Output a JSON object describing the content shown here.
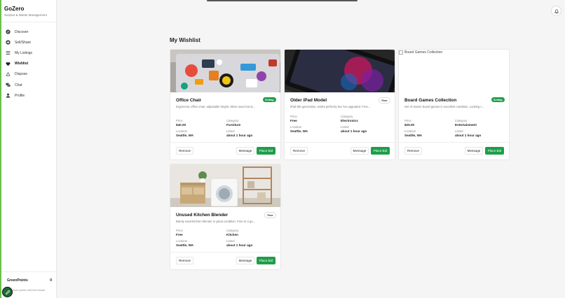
{
  "app": {
    "name": "GoZero",
    "tagline": "Surplus & Waste Management"
  },
  "nav": [
    {
      "label": "Discover",
      "icon": "compass-icon",
      "active": false
    },
    {
      "label": "Sell/Share",
      "icon": "plus-circle-icon",
      "active": false
    },
    {
      "label": "My Listings",
      "icon": "list-icon",
      "active": false
    },
    {
      "label": "Wishlist",
      "icon": "heart-icon",
      "active": true
    },
    {
      "label": "Dispose",
      "icon": "recycle-icon",
      "active": false
    },
    {
      "label": "Chat",
      "icon": "chat-bubbles-icon",
      "active": false
    },
    {
      "label": "Profile",
      "icon": "user-icon",
      "active": false
    }
  ],
  "greenpoints": {
    "label": "GreenPoints",
    "value": "0",
    "note": "more points until next reward"
  },
  "page": {
    "title": "My Wishlist"
  },
  "labels": {
    "price": "Price",
    "category": "Category",
    "location": "Location",
    "listed": "Listed",
    "remove": "Remove",
    "message": "Message",
    "place_bid": "Place Bid"
  },
  "items": [
    {
      "title": "Office Chair",
      "badge": "Selling",
      "description": "Ergonomic office chair, adjustable height. Minor wear but st...",
      "price": "$40.00",
      "category": "Furniture",
      "location": "Seattle, WA",
      "listed": "about 1 hour ago",
      "image": "laptop-stickers-photo"
    },
    {
      "title": "Older iPad Model",
      "badge": "Free",
      "description": "iPad 6th generation, works perfectly but I've upgraded. Free...",
      "price": "Free",
      "category": "Electronics",
      "location": "Seattle, WA",
      "listed": "about 1 hour ago",
      "image": "ipad-photo"
    },
    {
      "title": "Board Games Collection",
      "badge": "Selling",
      "description": "Set of classic board games in excellent condition. Looking t...",
      "price": "$25.00",
      "category": "Entertainment",
      "location": "Seattle, WA",
      "listed": "about 1 hour ago",
      "image_alt": "Board Games Collection"
    },
    {
      "title": "Unused Kitchen Blender",
      "badge": "Free",
      "description": "Barely used kitchen blender in great condition. Free to a go...",
      "price": "Free",
      "category": "Kitchen",
      "location": "Seattle, WA",
      "listed": "about 1 hour ago",
      "image": "laundry-room-photo"
    }
  ],
  "colors": {
    "accent": "#1e9e4a",
    "brand_edge": "#6cc04a",
    "fab": "#1d6a35"
  }
}
